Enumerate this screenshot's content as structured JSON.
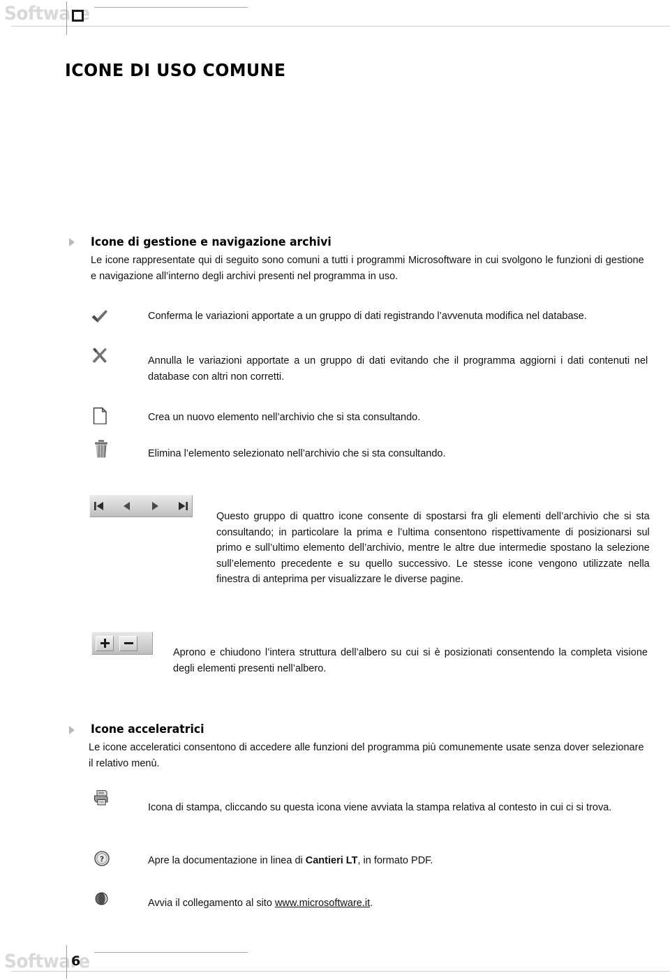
{
  "header": {
    "brand": "Software",
    "square_icon": "square-icon"
  },
  "title": "ICONE DI USO COMUNE",
  "sections": [
    {
      "heading": "Icone di gestione e navigazione archivi",
      "intro": "Le icone rappresentate qui di seguito  sono comuni a tutti i programmi Microsoftware in cui svolgono le funzioni di gestione e navigazione all’interno degli archivi presenti nel programma in uso.",
      "entries": [
        {
          "icon": "checkmark-icon",
          "text": "Conferma le variazioni apportate a un gruppo di dati registrando l’avvenuta modifica nel database."
        },
        {
          "icon": "cancel-x-icon",
          "text": "Annulla le variazioni apportate a un gruppo di dati evitando che il programma aggiorni i dati contenuti nel database con altri non corretti."
        },
        {
          "icon": "new-document-icon",
          "text": "Crea un nuovo elemento nell’archivio che si sta consultando."
        },
        {
          "icon": "trash-icon",
          "text": "Elimina l’elemento selezionato nell’archivio che si sta consultando."
        },
        {
          "icon": "record-navigation-group",
          "text": "Questo gruppo di quattro icone consente di spostarsi fra gli elementi dell’archivio che si sta consultando; in particolare la prima e l’ultima consentono rispettivamente di posizionarsi sul primo e sull’ultimo elemento dell’archivio, mentre le altre due intermedie spostano la selezione sull’elemento precedente e su quello successivo. Le stesse icone vengono utilizzate nella finestra di anteprima per visualizzare le diverse pagine."
        },
        {
          "icon": "expand-collapse-group",
          "text": "Aprono e chiudono l’intera struttura dell’albero su cui si è posizionati consentendo la completa visione degli elementi presenti nell’albero."
        }
      ]
    },
    {
      "heading": "Icone acceleratrici",
      "intro": "Le icone acceleratici consentono di accedere alle funzioni del programma più comunemente usate senza dover selezionare il relativo menù.",
      "entries": [
        {
          "icon": "printer-icon",
          "text": "Icona di stampa, cliccando su questa icona viene avviata la stampa relativa al contesto in cui ci si trova."
        },
        {
          "icon": "help-icon",
          "text_before": "Apre la documentazione in linea di ",
          "text_bold": "Cantieri LT",
          "text_after": ", in formato PDF."
        },
        {
          "icon": "globe-icon",
          "text_before": "Avvia il collegamento al sito ",
          "text_link": "www.microsoftware.it",
          "text_after": "."
        }
      ]
    }
  ],
  "nav_buttons": [
    {
      "name": "first-record-button",
      "glyph": "first"
    },
    {
      "name": "previous-record-button",
      "glyph": "prev"
    },
    {
      "name": "next-record-button",
      "glyph": "next"
    },
    {
      "name": "last-record-button",
      "glyph": "last"
    }
  ],
  "tree_buttons": [
    {
      "name": "expand-all-button",
      "glyph": "plus"
    },
    {
      "name": "collapse-all-button",
      "glyph": "minus"
    }
  ],
  "footer": {
    "brand": "Software",
    "page_number": "6"
  }
}
